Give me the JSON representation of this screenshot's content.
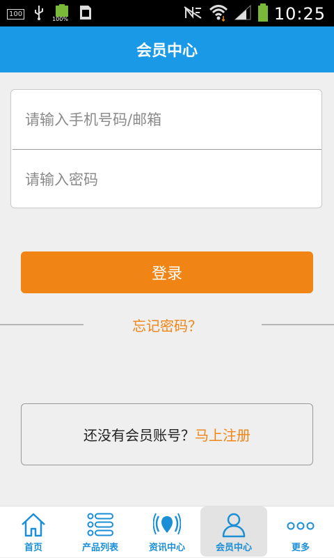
{
  "status_bar": {
    "battery_text": "100",
    "battery_percent": "100%",
    "time": "10:25"
  },
  "header": {
    "title": "会员中心"
  },
  "login_form": {
    "phone_placeholder": "请输入手机号码/邮箱",
    "password_placeholder": "请输入密码",
    "login_button": "登录",
    "forgot_password": "忘记密码？"
  },
  "register": {
    "prompt": "还没有会员账号？",
    "link": "马上注册"
  },
  "tab_bar": {
    "items": [
      {
        "label": "首页",
        "icon": "home-icon"
      },
      {
        "label": "产品列表",
        "icon": "list-icon"
      },
      {
        "label": "资讯中心",
        "icon": "broadcast-icon"
      },
      {
        "label": "会员中心",
        "icon": "user-icon"
      },
      {
        "label": "更多",
        "icon": "more-icon"
      }
    ],
    "active_index": 3
  },
  "colors": {
    "primary_blue": "#1a9ae6",
    "accent_orange": "#f08414"
  }
}
